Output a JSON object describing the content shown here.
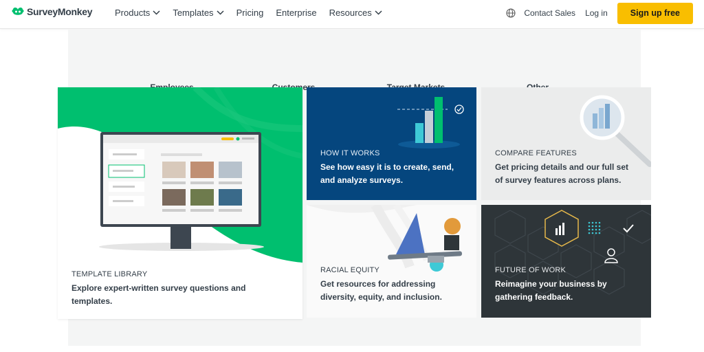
{
  "header": {
    "logo_text": "SurveyMonkey",
    "nav": [
      {
        "label": "Products",
        "dropdown": true
      },
      {
        "label": "Templates",
        "dropdown": true
      },
      {
        "label": "Pricing",
        "dropdown": false
      },
      {
        "label": "Enterprise",
        "dropdown": false
      },
      {
        "label": "Resources",
        "dropdown": true
      }
    ],
    "globe_icon": "globe-icon",
    "contact_sales": "Contact Sales",
    "login": "Log in",
    "signup": "Sign up free"
  },
  "tabs": [
    "Employees",
    "Customers",
    "Target Markets",
    "Other"
  ],
  "cards": [
    {
      "eyebrow": "TEMPLATE LIBRARY",
      "desc_1": "Explore expert-written survey questions and",
      "desc_2": "templates."
    },
    {
      "eyebrow": "HOW IT WORKS",
      "desc_1": "See how easy it is to create, send,",
      "desc_2": "and analyze surveys."
    },
    {
      "eyebrow": "COMPARE FEATURES",
      "desc_1": "Get pricing details and our full set",
      "desc_2": "of survey features across plans."
    },
    {
      "eyebrow": "RACIAL EQUITY",
      "desc_1": "Get resources for addressing",
      "desc_2": "diversity, equity, and inclusion."
    },
    {
      "eyebrow": "FUTURE OF WORK",
      "desc_1": "Reimagine your business by",
      "desc_2": "gathering feedback."
    }
  ],
  "colors": {
    "brand_green": "#00bf6f",
    "signup_yellow": "#f9be00",
    "navy": "#05467e",
    "dark": "#2e3539",
    "text": "#333e48"
  }
}
